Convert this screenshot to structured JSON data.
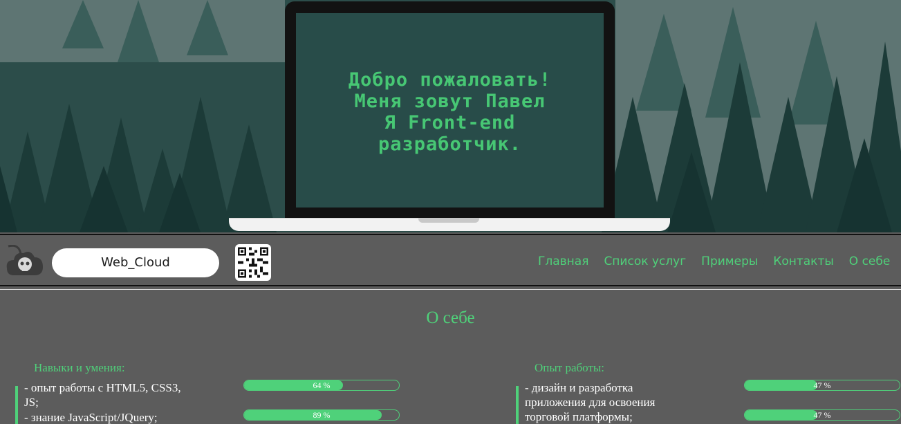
{
  "hero": {
    "line1": "Добро пожаловать!",
    "line2": "Меня зовут Павел",
    "line3": "Я Front-end",
    "line4": "разработчик."
  },
  "navbar": {
    "brand": "Web_Cloud",
    "links": [
      "Главная",
      "Список услуг",
      "Примеры",
      "Контакты",
      "О себе"
    ]
  },
  "about": {
    "title": "О себе",
    "skills": {
      "heading": "Навыки и умения:",
      "items": [
        {
          "text": "- опыт работы с HTML5, CSS3, JS;",
          "percent": 64,
          "label": "64 %"
        },
        {
          "text": "- знание JavaScript/JQuery;",
          "percent": 89,
          "label": "89 %"
        }
      ]
    },
    "experience": {
      "heading": "Опыт работы:",
      "items": [
        {
          "text": "- дизайн и разработка приложения для освоения торговой платформы;",
          "percent": 47,
          "label": "47 %"
        },
        {
          "text": "",
          "percent": 47,
          "label": "47 %"
        }
      ]
    }
  },
  "colors": {
    "accent": "#4fd17a",
    "background": "#5c5c5c",
    "hero": "#2d4f4c"
  }
}
